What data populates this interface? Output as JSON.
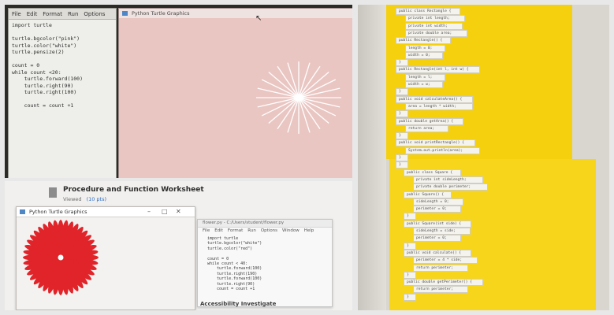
{
  "photo_a": {
    "editor": {
      "menu": [
        "File",
        "Edit",
        "Format",
        "Run",
        "Options"
      ],
      "code_lines": [
        "import turtle",
        "",
        "turtle.bgcolor(\"pink\")",
        "turtle.color(\"white\")",
        "turtle.pensize(2)",
        "",
        "count = 0",
        "while count <20:",
        "    turtle.forward(100)",
        "    turtle.right(90)",
        "    turtle.right(100)",
        "",
        "    count = count +1"
      ]
    },
    "turtle_window": {
      "title": "Python Turtle Graphics",
      "colors": {
        "background": "#e9c6c2",
        "pen": "#ffffff"
      }
    }
  },
  "photo_b": {
    "worksheet": {
      "title": "Procedure and Function Worksheet",
      "subtitle": "Viewed",
      "badge": "(10 pts)"
    },
    "turtle_window": {
      "title": "Python Turtle Graphics",
      "colors": {
        "pen": "#e0242a",
        "background": "#f4f2f0"
      }
    },
    "editor": {
      "title": "flower.py - C:/Users/student/flower.py",
      "menu": [
        "File",
        "Edit",
        "Format",
        "Run",
        "Options",
        "Window",
        "Help"
      ],
      "code_lines": [
        "import turtle",
        "turtle.bgcolor(\"white\")",
        "turtle.color(\"red\")",
        "",
        "count = 0",
        "while count < 40:",
        "    turtle.forward(100)",
        "    turtle.right(190)",
        "    turtle.forward(100)",
        "    turtle.right(90)",
        "    count = count +1"
      ]
    },
    "footer_text": "Accessibility Investigate"
  },
  "photo_c": {
    "strips": [
      "public class Rectangle {",
      "   private int length;",
      "   private int width;",
      "   private double area;",
      "public Rectangle() {",
      "   length = 0;",
      "   width = 0;",
      "}",
      "public Rectangle(int l, int w) {",
      "   length = l;",
      "   width = w;",
      "}",
      "public void calculateArea() {",
      "   area = length * width;",
      "}",
      "public double getArea() {",
      "   return area;",
      "}",
      "public void printRectangle() {",
      "   System.out.println(area);",
      "}",
      "}",
      "public class Square {",
      "   private int sideLength;",
      "   private double perimeter;",
      "public Square() {",
      "   sideLength = 0;",
      "   perimeter = 0;",
      "}",
      "public Square(int side) {",
      "   sideLength = side;",
      "   perimeter = 0;",
      "}",
      "public void calculate() {",
      "   perimeter = 4 * side;",
      "   return perimeter;",
      "}",
      "public double getPerimeter() {",
      "   return perimeter;",
      "}"
    ]
  }
}
